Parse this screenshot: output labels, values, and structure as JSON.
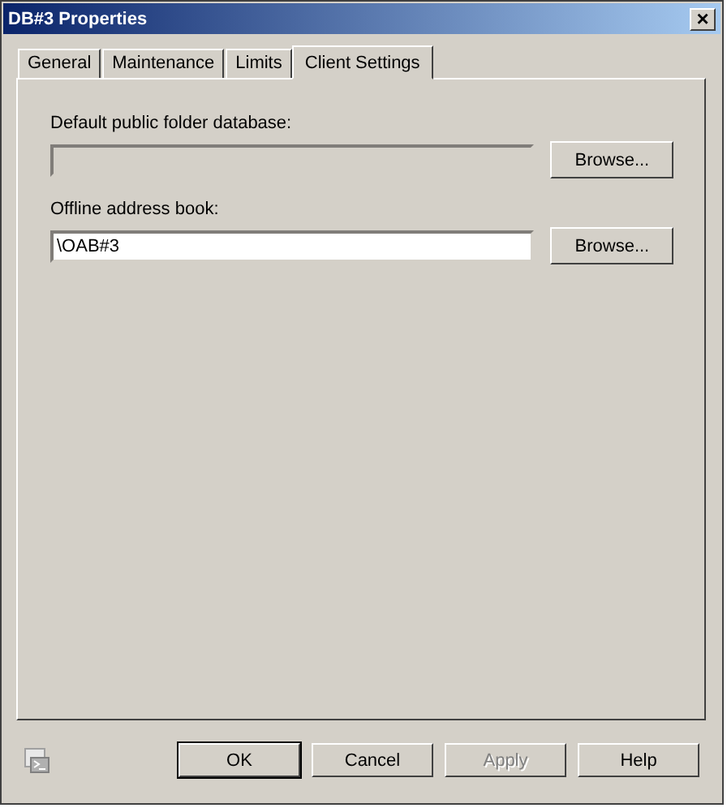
{
  "window": {
    "title": "DB#3 Properties",
    "close": "×"
  },
  "tabs": [
    {
      "label": "General",
      "selected": false
    },
    {
      "label": "Maintenance",
      "selected": false
    },
    {
      "label": "Limits",
      "selected": false
    },
    {
      "label": "Client Settings",
      "selected": true
    }
  ],
  "fields": [
    {
      "label": "Default public folder database:",
      "disabled": true,
      "button": "Browse..."
    },
    {
      "label": "Offline address book:",
      "value": "\\OAB#3",
      "disabled": false,
      "button": "Browse..."
    }
  ],
  "buttons": [
    {
      "label": "OK",
      "default": true,
      "disabled": false
    },
    {
      "label": "Cancel",
      "default": false,
      "disabled": false
    },
    {
      "label": "Apply",
      "default": false,
      "disabled": true
    },
    {
      "label": "Help",
      "default": false,
      "disabled": false
    }
  ]
}
